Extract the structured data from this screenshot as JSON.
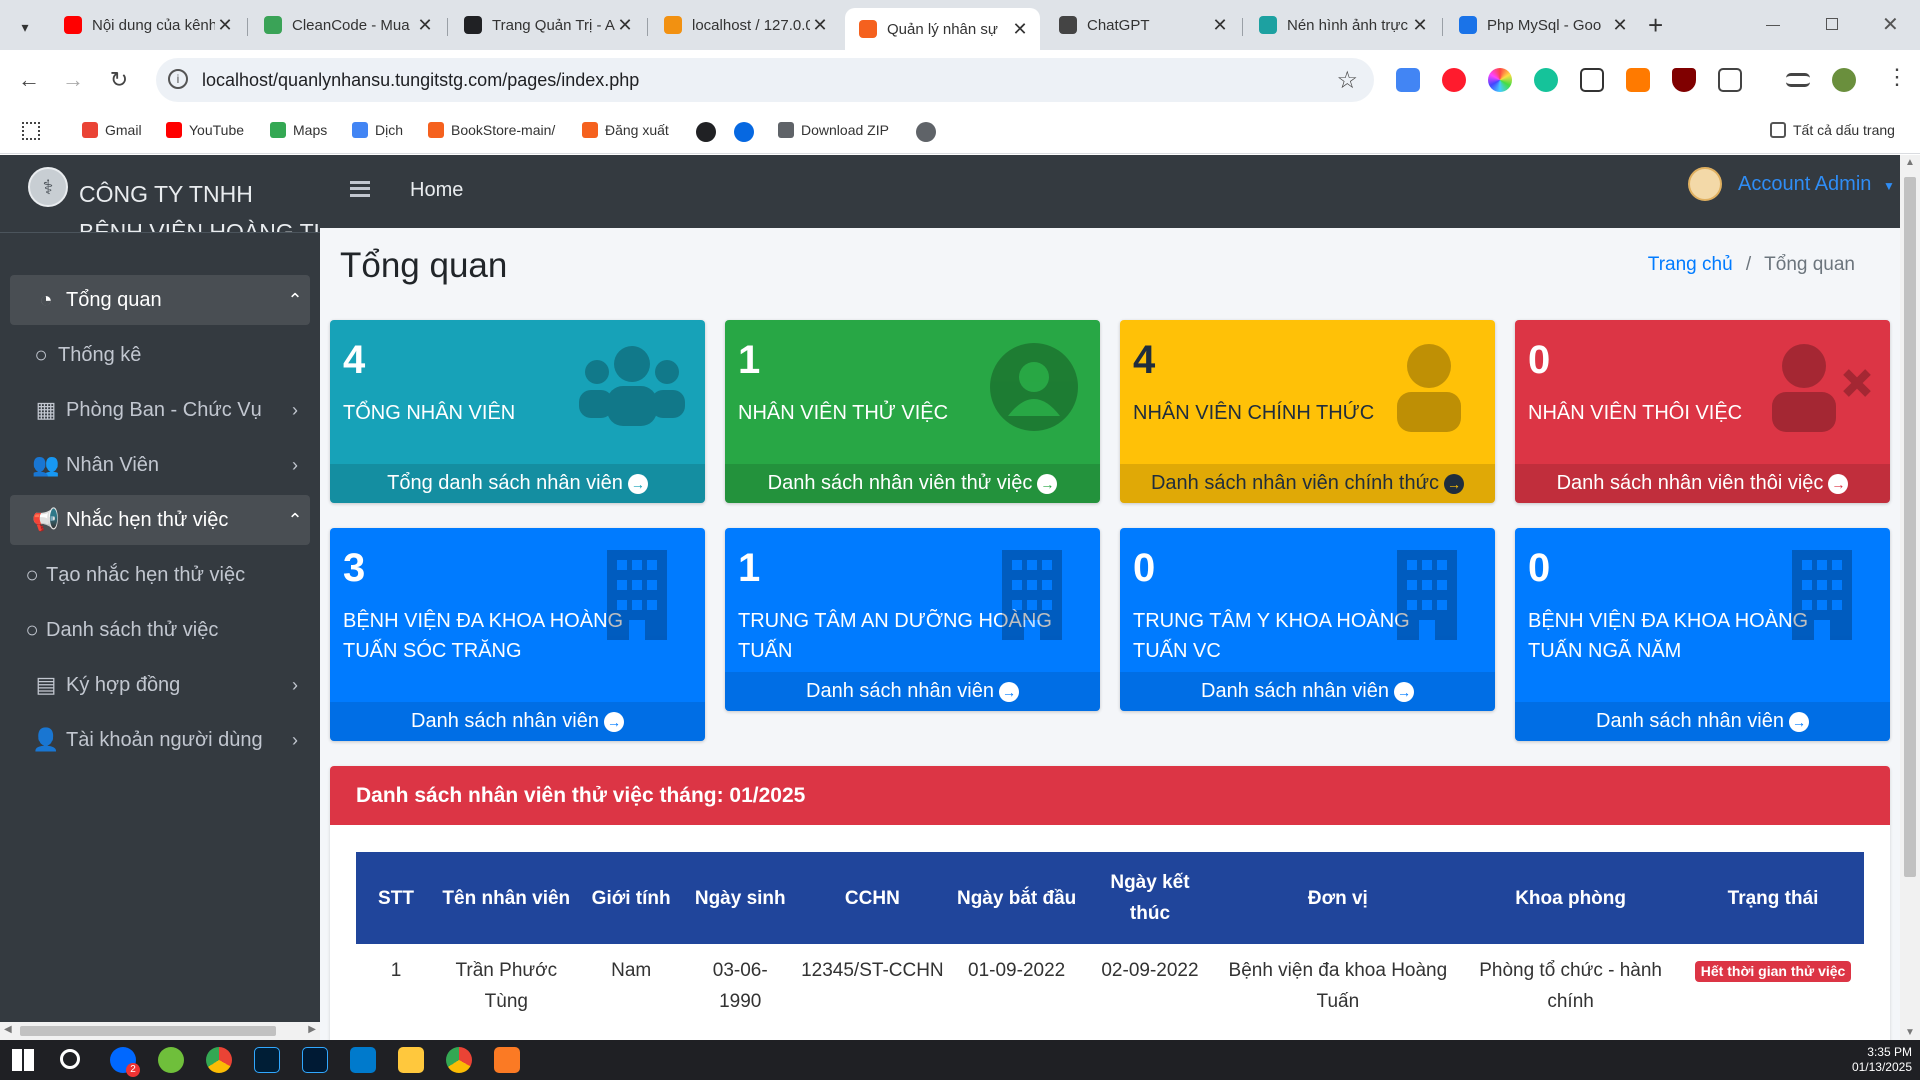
{
  "browser": {
    "tabs": [
      {
        "title": "Nội dung của kênh",
        "color": "#ff0000"
      },
      {
        "title": "CleanCode - Mua",
        "color": "#3aa357"
      },
      {
        "title": "Trang Quản Trị - A",
        "color": "#202124"
      },
      {
        "title": "localhost / 127.0.0",
        "color": "#f29111"
      },
      {
        "title": "Quản lý nhân sự",
        "color": "#f5611e"
      },
      {
        "title": "ChatGPT",
        "color": "#444444"
      },
      {
        "title": "Nén hình ảnh trực",
        "color": "#1da1a1"
      },
      {
        "title": "Php MySql - Goo",
        "color": "#1a73e8"
      }
    ],
    "new_tab": "+",
    "close_glyph": "✕",
    "url": "localhost/quanlynhansu.tungitstg.com/pages/index.php",
    "bookmarks": [
      {
        "label": "Gmail",
        "color": "#ea4335"
      },
      {
        "label": "YouTube",
        "color": "#ff0000"
      },
      {
        "label": "Maps",
        "color": "#34a853"
      },
      {
        "label": "Dịch",
        "color": "#4285f4"
      },
      {
        "label": "BookStore-main/",
        "color": "#f5611e"
      },
      {
        "label": "Đăng xuất",
        "color": "#f5611e"
      },
      {
        "label": "",
        "color": "#202124"
      },
      {
        "label": "",
        "color": "#0668e1"
      },
      {
        "label": "Download ZIP",
        "color": "#5f6368"
      },
      {
        "label": "",
        "color": "#5f6368"
      }
    ],
    "all_bookmarks": "Tất cả dấu trang"
  },
  "brand": {
    "line1": "CÔNG TY TNHH",
    "line2": "BỆNH VIỆN HOÀNG TUẤN"
  },
  "sidebar": {
    "items": [
      {
        "label": "Tổng quan",
        "icon": "dashboard-icon",
        "glyph": "◔",
        "arrow": "⌃",
        "open": true,
        "sub": false
      },
      {
        "label": "Thống kê",
        "icon": "circle-icon",
        "glyph": "○",
        "arrow": "",
        "open": false,
        "sub": true
      },
      {
        "label": "Phòng Ban - Chức Vụ",
        "icon": "building-icon",
        "glyph": "▦",
        "arrow": "›",
        "open": false,
        "sub": false
      },
      {
        "label": "Nhân Viên",
        "icon": "users-icon",
        "glyph": "👥",
        "arrow": "›",
        "open": false,
        "sub": false
      },
      {
        "label": "Nhắc hẹn thử việc",
        "icon": "megaphone-icon",
        "glyph": "📢",
        "arrow": "⌃",
        "open": true,
        "sub": false
      },
      {
        "label": "Tạo nhắc hẹn thử việc",
        "icon": "circle-icon",
        "glyph": "○",
        "arrow": "",
        "open": false,
        "sub": true
      },
      {
        "label": "Danh sách thử việc",
        "icon": "circle-icon",
        "glyph": "○",
        "arrow": "",
        "open": false,
        "sub": true
      },
      {
        "label": "Ký hợp đồng",
        "icon": "file-icon",
        "glyph": "▤",
        "arrow": "›",
        "open": false,
        "sub": false
      },
      {
        "label": "Tài khoản người dùng",
        "icon": "user-icon",
        "glyph": "👤",
        "arrow": "›",
        "open": false,
        "sub": false
      }
    ]
  },
  "topnav": {
    "home": "Home",
    "account": "Account Admin"
  },
  "page": {
    "title": "Tổng quan",
    "breadcrumb_home": "Trang chủ",
    "breadcrumb_sep": "/",
    "breadcrumb_current": "Tổng quan"
  },
  "stat_boxes": [
    {
      "value": "4",
      "label": "TỔNG NHÂN VIÊN",
      "link": "Tổng danh sách nhân viên",
      "color": "#17a2b8",
      "icon": "users-icon",
      "text": "#ffffff"
    },
    {
      "value": "1",
      "label": "NHÂN VIÊN THỬ VIỆC",
      "link": "Danh sách nhân viên thử việc",
      "color": "#28a745",
      "icon": "user-circle-icon",
      "text": "#ffffff"
    },
    {
      "value": "4",
      "label": "NHÂN VIÊN CHÍNH THỨC",
      "link": "Danh sách nhân viên chính thức",
      "color": "#ffc107",
      "icon": "user-icon",
      "text": "#1f2d3d"
    },
    {
      "value": "0",
      "label": "NHÂN VIÊN THÔI VIỆC",
      "link": "Danh sách nhân viên thôi việc",
      "color": "#dc3545",
      "icon": "user-times-icon",
      "text": "#ffffff"
    }
  ],
  "unit_boxes": [
    {
      "value": "3",
      "label": "BỆNH VIỆN ĐA KHOA HOÀNG TUẤN SÓC TRĂNG",
      "link": "Danh sách nhân viên",
      "color": "#007bff"
    },
    {
      "value": "1",
      "label": "TRUNG TÂM AN DƯỠNG HOÀNG TUẤN",
      "link": "Danh sách nhân viên",
      "color": "#007bff"
    },
    {
      "value": "0",
      "label": "TRUNG TÂM Y KHOA HOÀNG TUẤN VC",
      "link": "Danh sách nhân viên",
      "color": "#007bff"
    },
    {
      "value": "0",
      "label": "BỆNH VIỆN ĐA KHOA HOÀNG TUẤN NGÃ NĂM",
      "link": "Danh sách nhân viên",
      "color": "#007bff"
    }
  ],
  "probation": {
    "title": "Danh sách nhân viên thử việc tháng: 01/2025",
    "columns": [
      "STT",
      "Tên nhân viên",
      "Giới tính",
      "Ngày sinh",
      "CCHN",
      "Ngày bắt đầu",
      "Ngày kết thúc",
      "Đơn vị",
      "Khoa phòng",
      "Trạng thái"
    ],
    "rows": [
      {
        "cells": [
          "1",
          "Trần Phước Tùng",
          "Nam",
          "03-06-1990",
          "12345/ST-CCHN",
          "01-09-2022",
          "02-09-2022",
          "Bệnh viện đa khoa Hoàng Tuấn",
          "Phòng tổ chức - hành chính"
        ],
        "status": "Hết thời gian thử việc"
      }
    ]
  },
  "taskbar": {
    "time": "3:35 PM",
    "date": "01/13/2025",
    "badge": "2"
  }
}
